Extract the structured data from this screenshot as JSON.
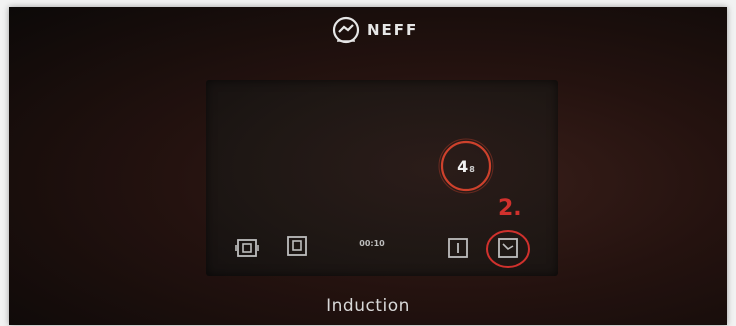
{
  "brand": {
    "name": "NEFF"
  },
  "display": {
    "power_level": "4",
    "power_subscript": "8",
    "timer": "00:10"
  },
  "annotation": {
    "step": "2."
  },
  "controls": [
    {
      "name": "hob-zone-left-icon"
    },
    {
      "name": "hob-zone-right-icon"
    },
    {
      "name": "timer-icon"
    },
    {
      "name": "cookware-sensor-icon"
    }
  ],
  "caption": "Induction",
  "colors": {
    "annotation_red": "#d0312d",
    "ring_orange": "#e0462f",
    "icon_gray": "#bdbdbd"
  }
}
